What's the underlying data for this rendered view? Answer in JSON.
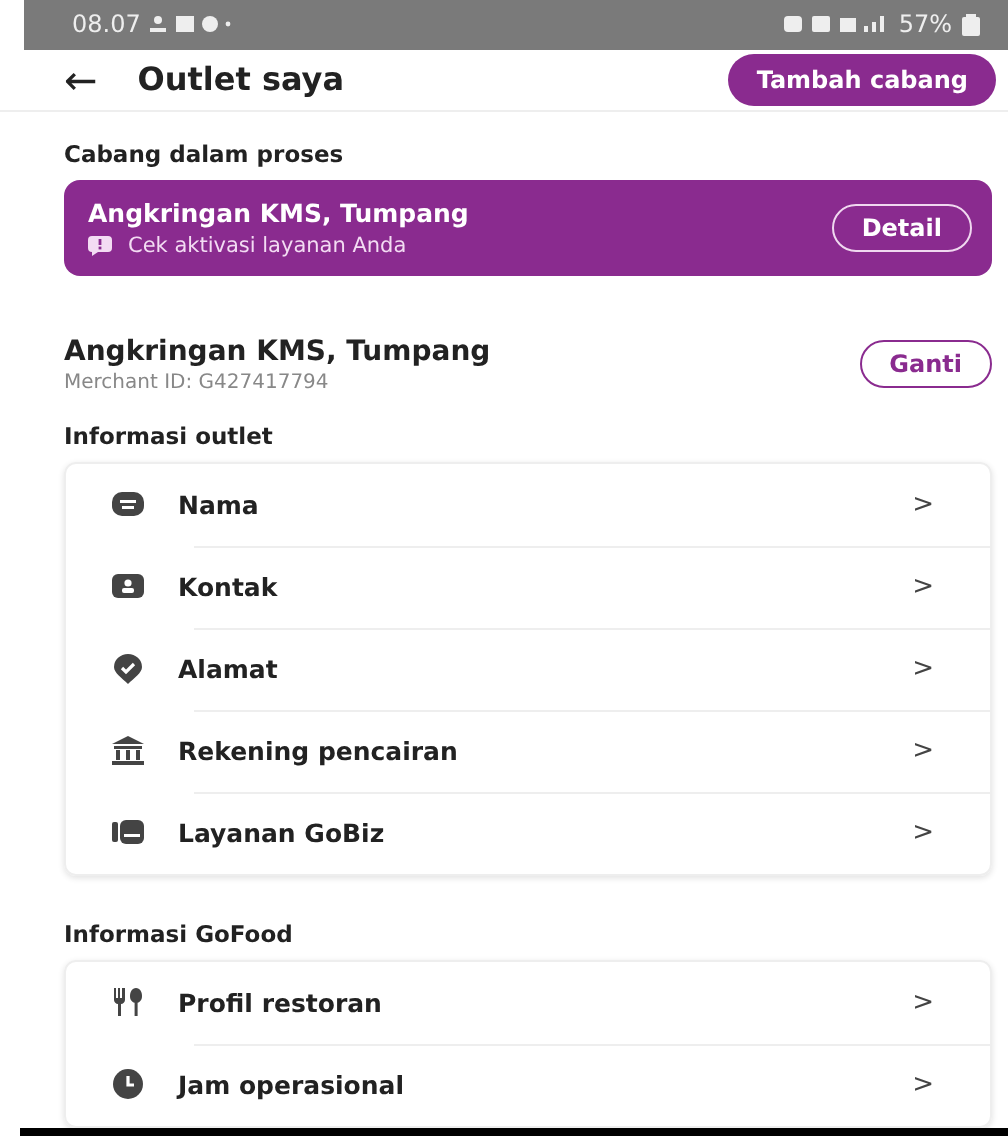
{
  "status_bar": {
    "time": "08.07",
    "battery": "57%"
  },
  "header": {
    "back": "←",
    "title": "Outlet saya",
    "action": "Tambah cabang"
  },
  "pending_section": {
    "heading": "Cabang dalam proses",
    "card": {
      "name": "Angkringan KMS, Tumpang",
      "message": "Cek aktivasi layanan Anda",
      "button": "Detail"
    }
  },
  "merchant": {
    "name": "Angkringan KMS, Tumpang",
    "merchant_id": "Merchant ID: G427417794",
    "button": "Ganti"
  },
  "outlet_info": {
    "heading": "Informasi outlet",
    "items": [
      {
        "label": "Nama",
        "chevron": ">"
      },
      {
        "label": "Kontak",
        "chevron": ">"
      },
      {
        "label": "Alamat",
        "chevron": ">"
      },
      {
        "label": "Rekening pencairan",
        "chevron": ">"
      },
      {
        "label": "Layanan GoBiz",
        "chevron": ">"
      }
    ]
  },
  "gofood_info": {
    "heading": "Informasi GoFood",
    "items": [
      {
        "label": "Profil restoran",
        "chevron": ">"
      },
      {
        "label": "Jam operasional",
        "chevron": ">"
      }
    ]
  }
}
